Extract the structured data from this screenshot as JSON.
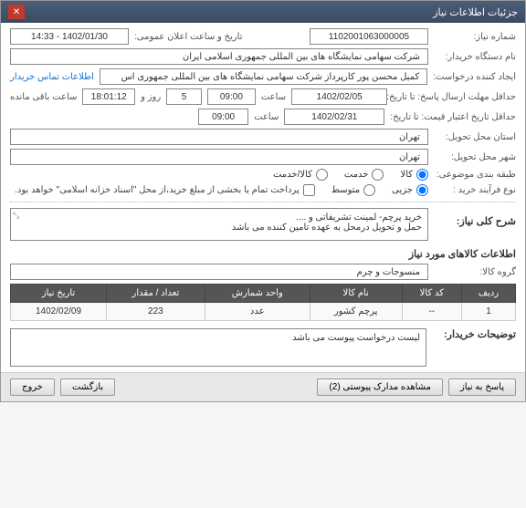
{
  "titlebar": {
    "title": "جزئیات اطلاعات نیاز"
  },
  "fields": {
    "need_no_label": "شماره نیاز:",
    "need_no": "1102001063000005",
    "announce_label": "تاریخ و ساعت اعلان عمومی:",
    "announce_value": "1402/01/30 - 14:33",
    "buyer_org_label": "نام دستگاه خریدار:",
    "buyer_org": "شرکت سهامی نمایشگاه های بین المللی جمهوری اسلامی ایران",
    "creator_label": "ایجاد کننده درخواست:",
    "creator": "کمیل محسن پور کارپرداز شرکت سهامی نمایشگاه های بین المللی جمهوری اس",
    "contact_link": "اطلاعات تماس خریدار",
    "deadline_label": "حداقل مهلت ارسال پاسخ: تا تاریخ:",
    "deadline_date": "1402/02/05",
    "time_label": "ساعت",
    "deadline_time": "09:00",
    "days_and": "روز و",
    "days_value": "5",
    "remaining_time": "18:01:12",
    "remaining_label": "ساعت باقی مانده",
    "validity_label": "حداقل تاریخ اعتبار قیمت: تا تاریخ:",
    "validity_date": "1402/02/31",
    "validity_time": "09:00",
    "province_label": "استان محل تحویل:",
    "province": "تهران",
    "city_label": "شهر محل تحویل:",
    "city": "تهران",
    "category_label": "طبقه بندی موضوعی:",
    "cat_goods": "کالا",
    "cat_service": "خدمت",
    "cat_goods_service": "کالا/خدمت",
    "buy_type_label": "نوع فرآیند خرید :",
    "buy_type_small": "جزیی",
    "buy_type_medium": "متوسط",
    "partial_pay": "پرداخت تمام یا بخشی از مبلغ خرید،از محل \"اسناد خزانه اسلامی\" خواهد بود.",
    "desc_label": "شرح کلی نیاز:",
    "desc_text": "خرید پرچم- لمینت تشریفاتی و ....\nحمل و تحویل درمحل به عهده تامین کننده می باشد",
    "items_header": "اطلاعات کالاهای مورد نیاز",
    "group_label": "گروه کالا:",
    "group_value": "منسوجات و چرم",
    "buyer_notes_label": "توضیحات خریدار:",
    "buyer_notes": "لیست درخواست پیوست می باشد"
  },
  "table": {
    "headers": [
      "ردیف",
      "کد کالا",
      "نام کالا",
      "واحد شمارش",
      "تعداد / مقدار",
      "تاریخ نیاز"
    ],
    "rows": [
      {
        "idx": "1",
        "code": "--",
        "name": "پرچم کشور",
        "unit": "عدد",
        "qty": "223",
        "date": "1402/02/09"
      }
    ]
  },
  "buttons": {
    "respond": "پاسخ به نیاز",
    "attachments": "مشاهده مدارک پیوستی (2)",
    "back": "بازگشت",
    "exit": "خروج"
  }
}
